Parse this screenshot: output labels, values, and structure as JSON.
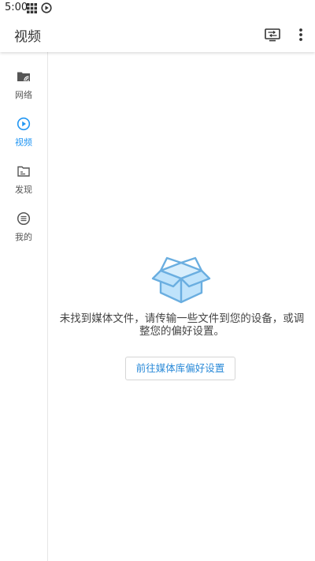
{
  "status_bar": {
    "time": "5:00",
    "icons": [
      "grid-icon",
      "play-circle-icon"
    ]
  },
  "app_bar": {
    "title": "视频",
    "actions": [
      "cast-icon",
      "more-vert-icon"
    ]
  },
  "sidebar": {
    "items": [
      {
        "label": "网络",
        "icon": "folder-network-icon",
        "active": false
      },
      {
        "label": "视频",
        "icon": "play-circle-icon",
        "active": true
      },
      {
        "label": "发现",
        "icon": "discover-folder-icon",
        "active": false
      },
      {
        "label": "我的",
        "icon": "menu-circle-icon",
        "active": false
      }
    ]
  },
  "main": {
    "empty_icon": "open-box-icon",
    "empty_message": "未找到媒体文件，请传输一些文件到您的设备，或调整您的偏好设置。",
    "button_label": "前往媒体库偏好设置"
  },
  "colors": {
    "accent": "#2196f3",
    "box_fill": "#bfe3fb",
    "box_stroke": "#6aaee0"
  }
}
